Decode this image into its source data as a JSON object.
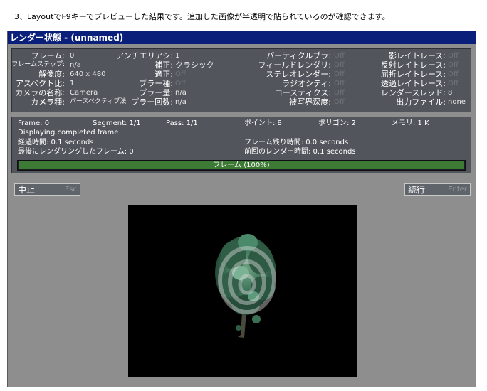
{
  "caption": "3、LayoutでF9キーでプレビューした結果です。追加した画像が半透明で貼られているのが確認できます。",
  "window": {
    "title": "レンダー状態 - (unnamed)"
  },
  "settings": {
    "col1": [
      {
        "label": "フレーム:",
        "value": "0"
      },
      {
        "label": "フレームステップ:",
        "value": "n/a"
      },
      {
        "label": "解像度:",
        "value": "640 x 480"
      },
      {
        "label": "アスペクト比:",
        "value": "1"
      },
      {
        "label": "カメラの名称:",
        "value": "Camera"
      },
      {
        "label": "カメラ種:",
        "value": "パースペクティブ法"
      }
    ],
    "col2": [
      {
        "label": "アンチエリアシ:",
        "value": "1"
      },
      {
        "label": "補正:",
        "value": "クラシック"
      },
      {
        "label": "適正:",
        "value": "Off"
      },
      {
        "label": "ブラー種:",
        "value": "Off"
      },
      {
        "label": "ブラー量:",
        "value": "n/a"
      },
      {
        "label": "ブラー回数:",
        "value": "n/a"
      }
    ],
    "col3": [
      {
        "label": "パーティクルブラ:",
        "value": "Off"
      },
      {
        "label": "フィールドレンダリ:",
        "value": "Off"
      },
      {
        "label": "ステレオレンダー:",
        "value": "Off"
      },
      {
        "label": "ラジオシティ:",
        "value": "Off"
      },
      {
        "label": "コースティクス:",
        "value": "Off"
      },
      {
        "label": "被写界深度:",
        "value": "Off"
      }
    ],
    "col4": [
      {
        "label": "影レイトレース:",
        "value": "Off"
      },
      {
        "label": "反射レイトレース:",
        "value": "Off"
      },
      {
        "label": "屈折レイトレース:",
        "value": "Off"
      },
      {
        "label": "透過レイトレース:",
        "value": "Off"
      },
      {
        "label": "レンダースレッド:",
        "value": "8"
      },
      {
        "label": "出力ファイル:",
        "value": "none"
      }
    ]
  },
  "status": {
    "frame": "Frame: 0",
    "segment": "Segment: 1/1",
    "pass": "Pass: 1/1",
    "points": "ポイント: 8",
    "polygons": "ポリゴン: 2",
    "memory": "メモリ: 1 K",
    "displaying": "Displaying completed frame",
    "elapsed": "経過時間: 0.1 seconds",
    "remaining": "フレーム残り時間: 0.0 seconds",
    "last_frame": "最後にレンダリングしたフレーム: 0",
    "prev_render": "前回のレンダー時間: 0.1 seconds",
    "progress_label": "フレーム (100%)",
    "progress_fraction": 1.0
  },
  "buttons": {
    "abort": "中止",
    "abort_hint": "Esc",
    "continue": "続行",
    "continue_hint": "Enter"
  },
  "colors": {
    "title_bg": "#0a1f7a",
    "progress_green": "#3c7a35",
    "panel": "#52565c"
  }
}
